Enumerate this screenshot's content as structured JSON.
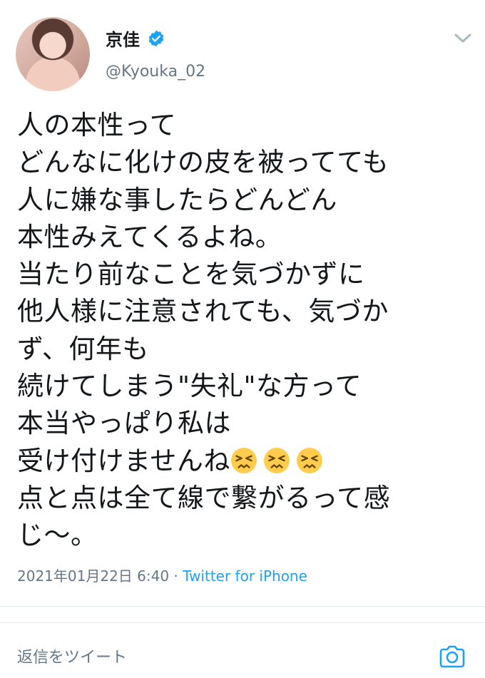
{
  "user": {
    "display_name": "京佳",
    "handle": "@Kyouka_02",
    "verified": true
  },
  "tweet": {
    "text": "人の本性って\nどんなに化けの皮を被ってても\n人に嫌な事したらどんどん\n本性みえてくるよね。\n当たり前なことを気づかずに\n他人様に注意されても、気づか\nず、何年も\n続けてしまう\"失礼\"な方って\n本当やっぱり私は\n受け付けませんね",
    "text_tail": "点と点は全て線で繋がるって感\nじ〜。",
    "emoji": [
      "persevering-face",
      "persevering-face",
      "persevering-face"
    ]
  },
  "meta": {
    "timestamp": "2021年01月22日 6:40",
    "separator": " · ",
    "source": "Twitter for iPhone"
  },
  "reply_bar": {
    "placeholder": "返信をツイート",
    "camera_icon": "camera-icon"
  },
  "colors": {
    "accent": "#1da1f2",
    "muted": "#657786",
    "divider": "#e6ecf0",
    "emoji_face": "#ffcc4d"
  }
}
